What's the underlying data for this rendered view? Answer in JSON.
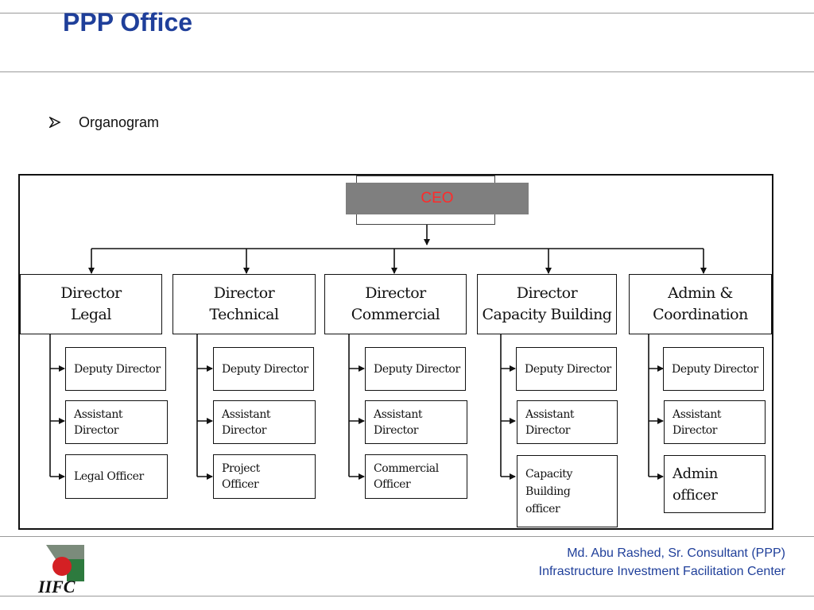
{
  "slide": {
    "title": "PPP Office",
    "bullet": "Organogram"
  },
  "org": {
    "ceo": "CEO",
    "directors": [
      {
        "label": "Director\nLegal",
        "subs": [
          "Deputy Director",
          "Assistant\nDirector",
          "Legal Officer"
        ]
      },
      {
        "label": "Director\nTechnical",
        "subs": [
          "Deputy Director",
          "Assistant\nDirector",
          "Project\nOfficer"
        ]
      },
      {
        "label": "Director\nCommercial",
        "subs": [
          "Deputy Director",
          "Assistant\nDirector",
          "Commercial\nOfficer"
        ]
      },
      {
        "label": "Director\nCapacity Building",
        "subs": [
          "Deputy Director",
          "Assistant\nDirector",
          "Capacity\nBuilding\nofficer"
        ]
      },
      {
        "label": "Admin &\nCoordination",
        "subs": [
          "Deputy Director",
          "Assistant\nDirector",
          "Admin\nofficer"
        ]
      }
    ]
  },
  "footer": {
    "line1": "Md. Abu Rashed, Sr. Consultant (PPP)",
    "line2": "Infrastructure Investment Facilitation Center",
    "logo_text": "IIFC"
  },
  "colors": {
    "title": "#1f3f9a",
    "ceo_fill": "#7f7f7f",
    "ceo_text": "#ff2a2a"
  }
}
